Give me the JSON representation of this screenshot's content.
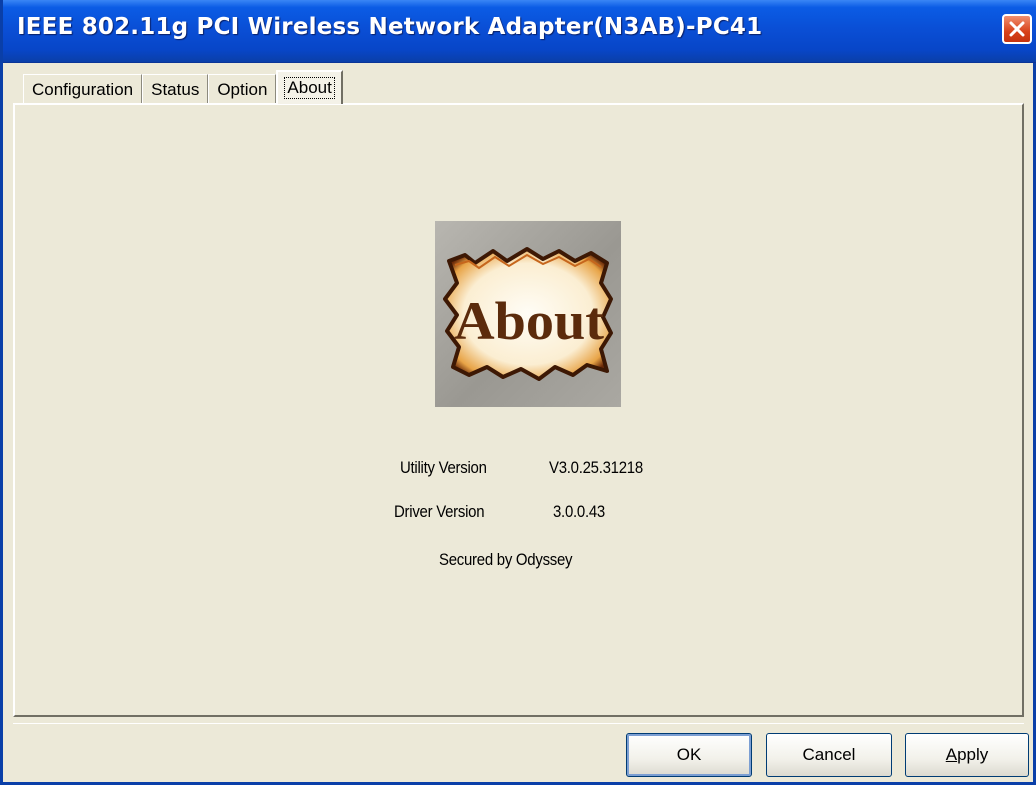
{
  "window": {
    "title": "IEEE 802.11g PCI Wireless Network Adapter(N3AB)-PC41"
  },
  "tabs": [
    {
      "label": "Configuration",
      "active": false
    },
    {
      "label": "Status",
      "active": false
    },
    {
      "label": "Option",
      "active": false
    },
    {
      "label": "About",
      "active": true
    }
  ],
  "about": {
    "logo_text": "About",
    "utility_version_label": "Utility Version",
    "utility_version_value": "V3.0.25.31218",
    "driver_version_label": "Driver Version",
    "driver_version_value": "3.0.0.43",
    "secured_by": "Secured by Odyssey"
  },
  "buttons": {
    "ok": "OK",
    "cancel": "Cancel",
    "apply_first": "A",
    "apply_rest": "pply"
  },
  "colors": {
    "titlebar": "#0a4fd6",
    "face": "#ece9d8",
    "close": "#d8421a"
  }
}
